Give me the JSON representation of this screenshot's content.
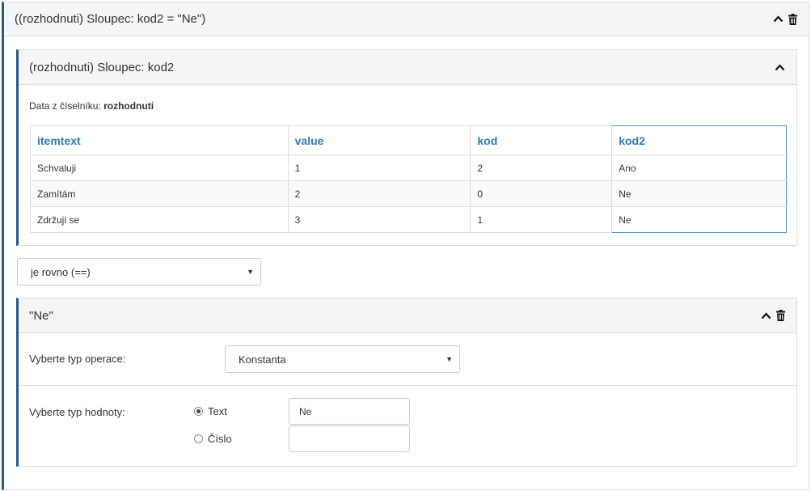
{
  "outer_panel": {
    "title": "((rozhodnuti) Sloupec: kod2 = \"Ne\")"
  },
  "column_panel": {
    "title": "(rozhodnuti) Sloupec: kod2",
    "source_prefix": "Data z číselníku:",
    "source_name": "rozhodnuti",
    "table": {
      "headers": [
        "itemtext",
        "value",
        "kod",
        "kod2"
      ],
      "rows": [
        [
          "Schvaluji",
          "1",
          "2",
          "Ano"
        ],
        [
          "Zamítám",
          "2",
          "0",
          "Ne"
        ],
        [
          "Zdržuji se",
          "3",
          "1",
          "Ne"
        ]
      ]
    }
  },
  "operator_select": {
    "value": "je rovno (==)"
  },
  "value_panel": {
    "title": "\"Ne\"",
    "operation_label": "Vyberte typ operace:",
    "operation_value": "Konstanta",
    "value_type_label": "Vyberte typ hodnoty:",
    "radio_text": "Text",
    "radio_number": "Číslo",
    "text_value": "Ne",
    "number_value": ""
  },
  "colors": {
    "accent": "#2a5a82",
    "header_text": "#337ab7",
    "highlight_border": "#4a90d9"
  },
  "icons": [
    "chevron-up-icon",
    "trash-icon",
    "caret-down-icon",
    "radio-icon"
  ]
}
